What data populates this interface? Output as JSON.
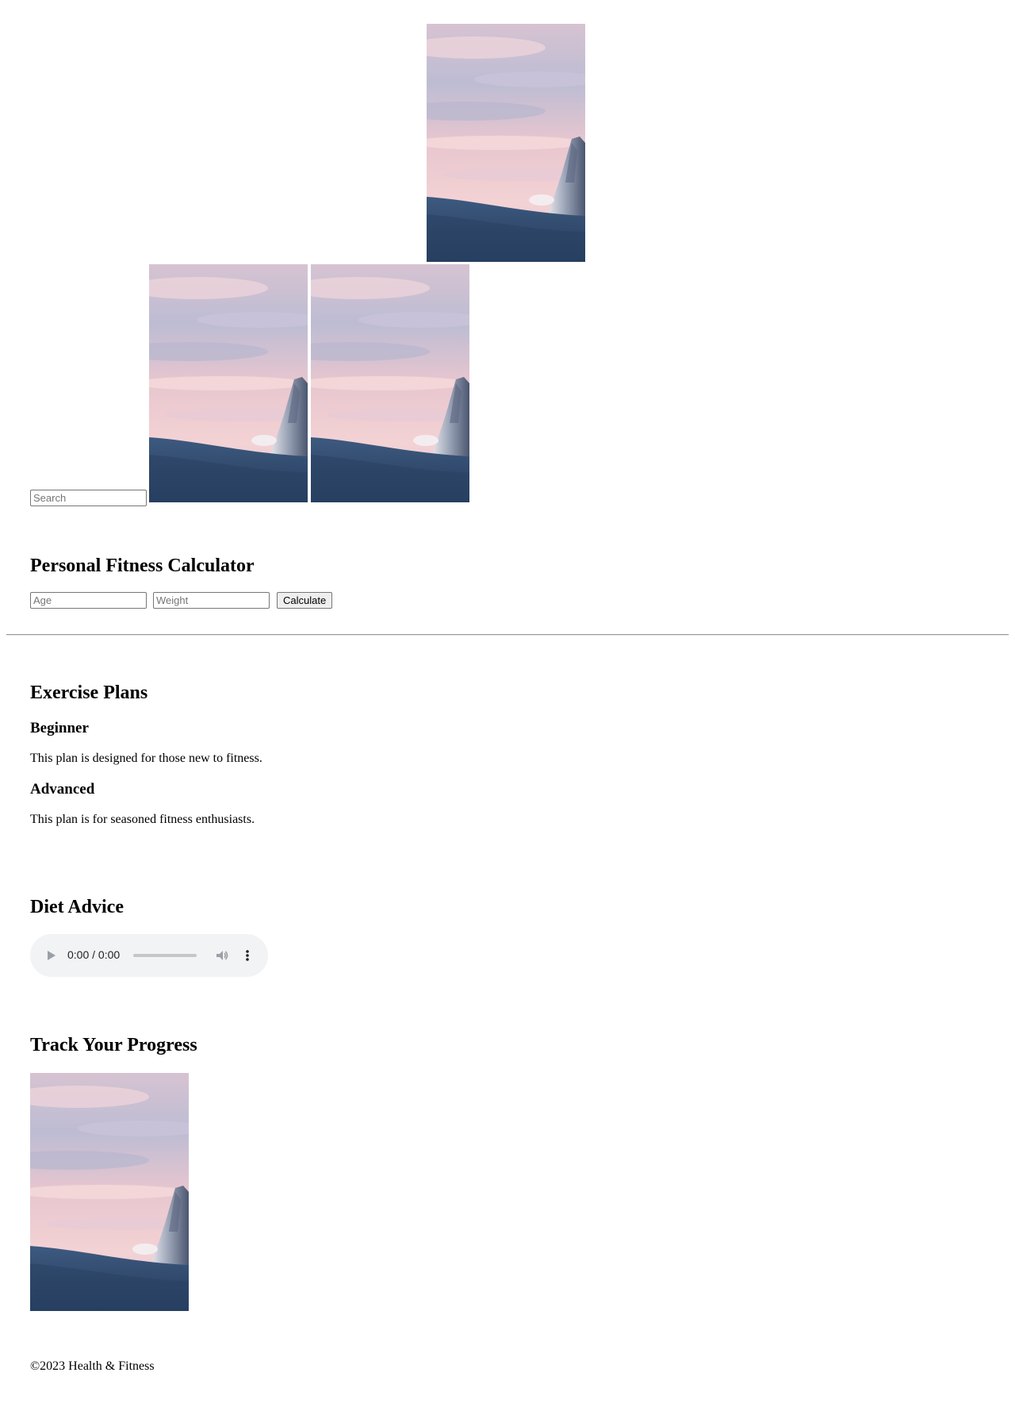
{
  "images": {
    "alt": "",
    "sky_colors": [
      "#bdbcd3",
      "#e8c6cf",
      "#f3d2d4",
      "#d9c9dc"
    ],
    "ground_color": "#2e4769"
  },
  "search": {
    "placeholder": "Search",
    "value": ""
  },
  "calculator": {
    "title": "Personal Fitness Calculator",
    "age_placeholder": "Age",
    "weight_placeholder": "Weight",
    "calculate_label": "Calculate"
  },
  "exercise": {
    "title": "Exercise Plans",
    "plans": [
      {
        "name": "Beginner",
        "description": "This plan is designed for those new to fitness."
      },
      {
        "name": "Advanced",
        "description": "This plan is for seasoned fitness enthusiasts."
      }
    ]
  },
  "diet": {
    "title": "Diet Advice",
    "audio": {
      "time_display": "0:00 / 0:00",
      "progress": 0,
      "play_icon": "play-icon",
      "volume_icon": "volume-icon",
      "more_icon": "more-vertical-icon"
    }
  },
  "progress": {
    "title": "Track Your Progress"
  },
  "footer": {
    "text": "©2023 Health & Fitness"
  }
}
